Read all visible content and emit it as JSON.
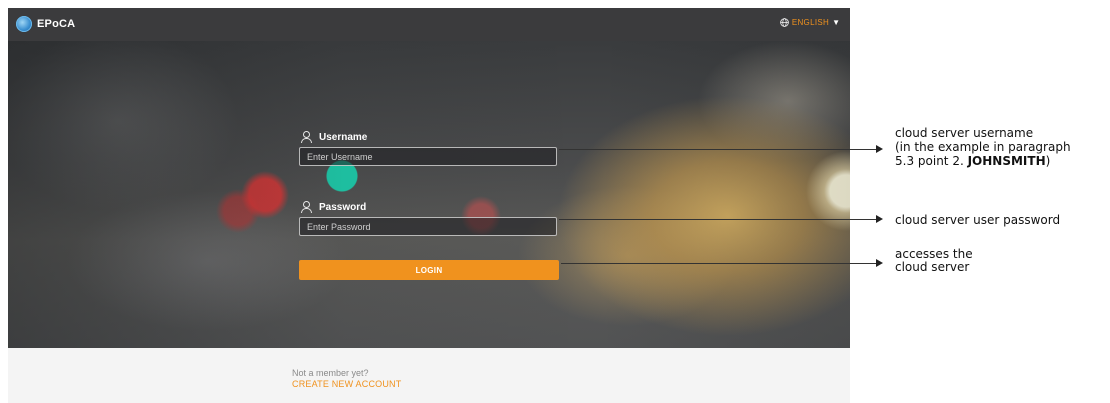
{
  "header": {
    "app_name": "EPoCA",
    "language": "ENGLISH"
  },
  "form": {
    "username_label": "Username",
    "username_placeholder": "Enter Username",
    "password_label": "Password",
    "password_placeholder": "Enter Password",
    "login_label": "LOGIN"
  },
  "footer": {
    "prompt": "Not a member yet?",
    "create_account": "CREATE NEW ACCOUNT"
  },
  "annotations": {
    "username": {
      "line1": "cloud server username",
      "line2": "(in the example in paragraph",
      "line3_prefix": "5.3 point 2. ",
      "line3_bold": "JOHNSMITH",
      "line3_suffix": ")"
    },
    "password": {
      "line1": "cloud server user password"
    },
    "login": {
      "line1": "accesses the",
      "line2": "cloud server"
    }
  },
  "colors": {
    "accent": "#f0921e",
    "topbar": "#3b3b3d",
    "focus_dot": "#1fc7a7"
  }
}
